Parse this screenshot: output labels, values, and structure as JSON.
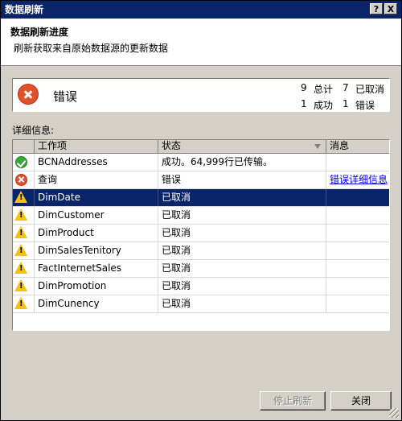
{
  "window": {
    "title": "数据刷新",
    "help_label": "?",
    "close_label": "X"
  },
  "header": {
    "title": "数据刷新进度",
    "subtitle": "刷新获取来自原始数据源的更新数据"
  },
  "status": {
    "label": "错误",
    "total_count": "9",
    "total_label": "总计",
    "cancelled_count": "7",
    "cancelled_label": "已取消",
    "success_count": "1",
    "success_label": "成功",
    "error_count": "1",
    "error_label": "错误"
  },
  "details": {
    "label": "详细信息:",
    "columns": {
      "work_item": "工作项",
      "status": "状态",
      "message": "消息"
    },
    "rows": [
      {
        "icon": "success-icon",
        "work_item": "BCNAddresses",
        "status": "成功。64,999行已传输。",
        "message": "",
        "selected": false
      },
      {
        "icon": "error-icon",
        "work_item": "查询",
        "status": "错误",
        "message": "错误详细信息",
        "selected": false
      },
      {
        "icon": "warning-icon",
        "work_item": "DimDate",
        "status": "已取消",
        "message": "",
        "selected": true
      },
      {
        "icon": "warning-icon",
        "work_item": "DimCustomer",
        "status": "已取消",
        "message": "",
        "selected": false
      },
      {
        "icon": "warning-icon",
        "work_item": "DimProduct",
        "status": "已取消",
        "message": "",
        "selected": false
      },
      {
        "icon": "warning-icon",
        "work_item": "DimSalesTenitory",
        "status": "已取消",
        "message": "",
        "selected": false
      },
      {
        "icon": "warning-icon",
        "work_item": "FactInternetSales",
        "status": "已取消",
        "message": "",
        "selected": false
      },
      {
        "icon": "warning-icon",
        "work_item": "DimPromotion",
        "status": "已取消",
        "message": "",
        "selected": false
      },
      {
        "icon": "warning-icon",
        "work_item": "DimCunency",
        "status": "已取消",
        "message": "",
        "selected": false
      }
    ]
  },
  "buttons": {
    "stop_label": "停止刷新",
    "close_label": "关闭"
  },
  "colors": {
    "titlebar": "#0a246a",
    "selection": "#0a246a",
    "error": "#e0502a",
    "success": "#3aa83a",
    "warning": "#f4c20d",
    "link": "#0000ee"
  }
}
